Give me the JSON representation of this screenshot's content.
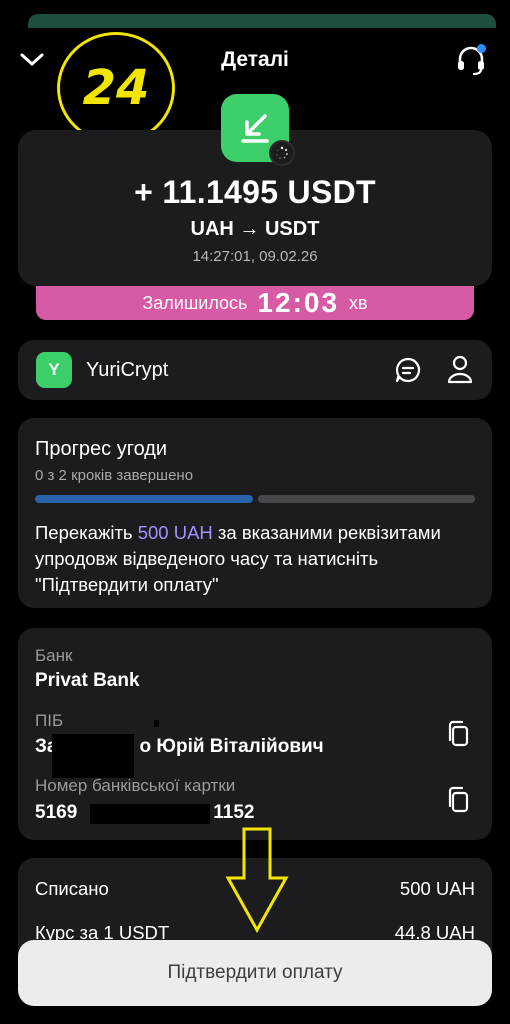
{
  "header": {
    "title": "Деталі"
  },
  "annotation": {
    "step_number": "24"
  },
  "transaction": {
    "amount": "+ 11.1495 USDT",
    "pair": "UAH → USDT",
    "datetime": "14:27:01, 09.02.26"
  },
  "timer": {
    "label": "Залишилось",
    "value": "12:03",
    "unit": "хв"
  },
  "merchant": {
    "avatar_letter": "Y",
    "name": "YuriCrypt"
  },
  "progress": {
    "title": "Прогрес угоди",
    "steps_text": "0 з 2 кроків завершено",
    "completed_steps": 0,
    "total_steps": 2,
    "instruction_before": "Перекажіть ",
    "instruction_amount": "500 UAH",
    "instruction_after": " за вказаними реквізитами упродовж відведеного часу та натисніть \"Підтвердити оплату\""
  },
  "bank_details": {
    "bank_label": "Банк",
    "bank_value": "Privat Bank",
    "name_label": "ПІБ",
    "name_value_start": "За",
    "name_value_end": "о Юрій Віталійович",
    "card_label": "Номер банківської картки",
    "card_value_start": "5169",
    "card_value_end": "1152"
  },
  "summary": {
    "rows": [
      {
        "label": "Списано",
        "value": "500 UAH"
      },
      {
        "label": "Курс за 1 USDT",
        "value": "44.8 UAH"
      }
    ]
  },
  "actions": {
    "confirm_label": "Підтвердити оплату"
  },
  "colors": {
    "accent_green": "#3ccf6a",
    "timer_pink": "#d85aa5",
    "progress_blue": "#2862a8",
    "highlight_purple": "#9f94ff",
    "annotation_yellow": "#f2e600"
  },
  "icons": {
    "back": "chevron-down-icon",
    "support": "headset-icon",
    "app": "arrow-down-left-icon",
    "pending": "loading-spinner-icon",
    "chat": "chat-bubble-icon",
    "profile": "user-icon",
    "copy": "copy-icon",
    "annotation_arrow": "down-arrow-annotation"
  }
}
